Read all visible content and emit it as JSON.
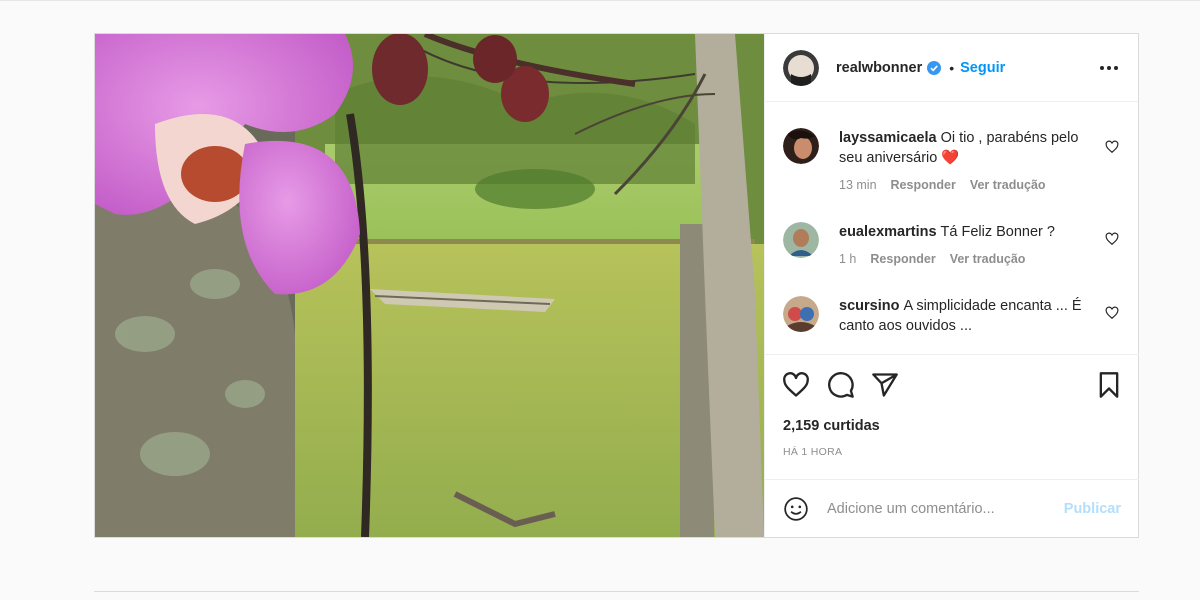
{
  "post": {
    "username": "realwbonner",
    "follow_label": "Seguir",
    "dot": "•",
    "avatar_icon": "user-avatar",
    "verified_color": "#3897f0"
  },
  "comments": [
    {
      "user": "layssamicaela",
      "text": "Oi tio , parabéns pelo seu aniversário ❤️",
      "time": "13 min",
      "reply": "Responder",
      "translate": "Ver tradução"
    },
    {
      "user": "eualexmartins",
      "text": "Tá Feliz Bonner ?",
      "time": "1 h",
      "reply": "Responder",
      "translate": "Ver tradução"
    },
    {
      "user": "scursino",
      "text": "A simplicidade encanta ... É canto aos ouvidos ...",
      "time": "",
      "reply": "",
      "translate": ""
    }
  ],
  "stats": {
    "likes": "2,159 curtidas",
    "posted": "HÁ 1 HORA"
  },
  "composer": {
    "placeholder": "Adicione um comentário...",
    "publish_label": "Publicar"
  },
  "colors": {
    "accent": "#0095f6",
    "publish_disabled": "#b2dffc",
    "heart": "#e0245e"
  }
}
